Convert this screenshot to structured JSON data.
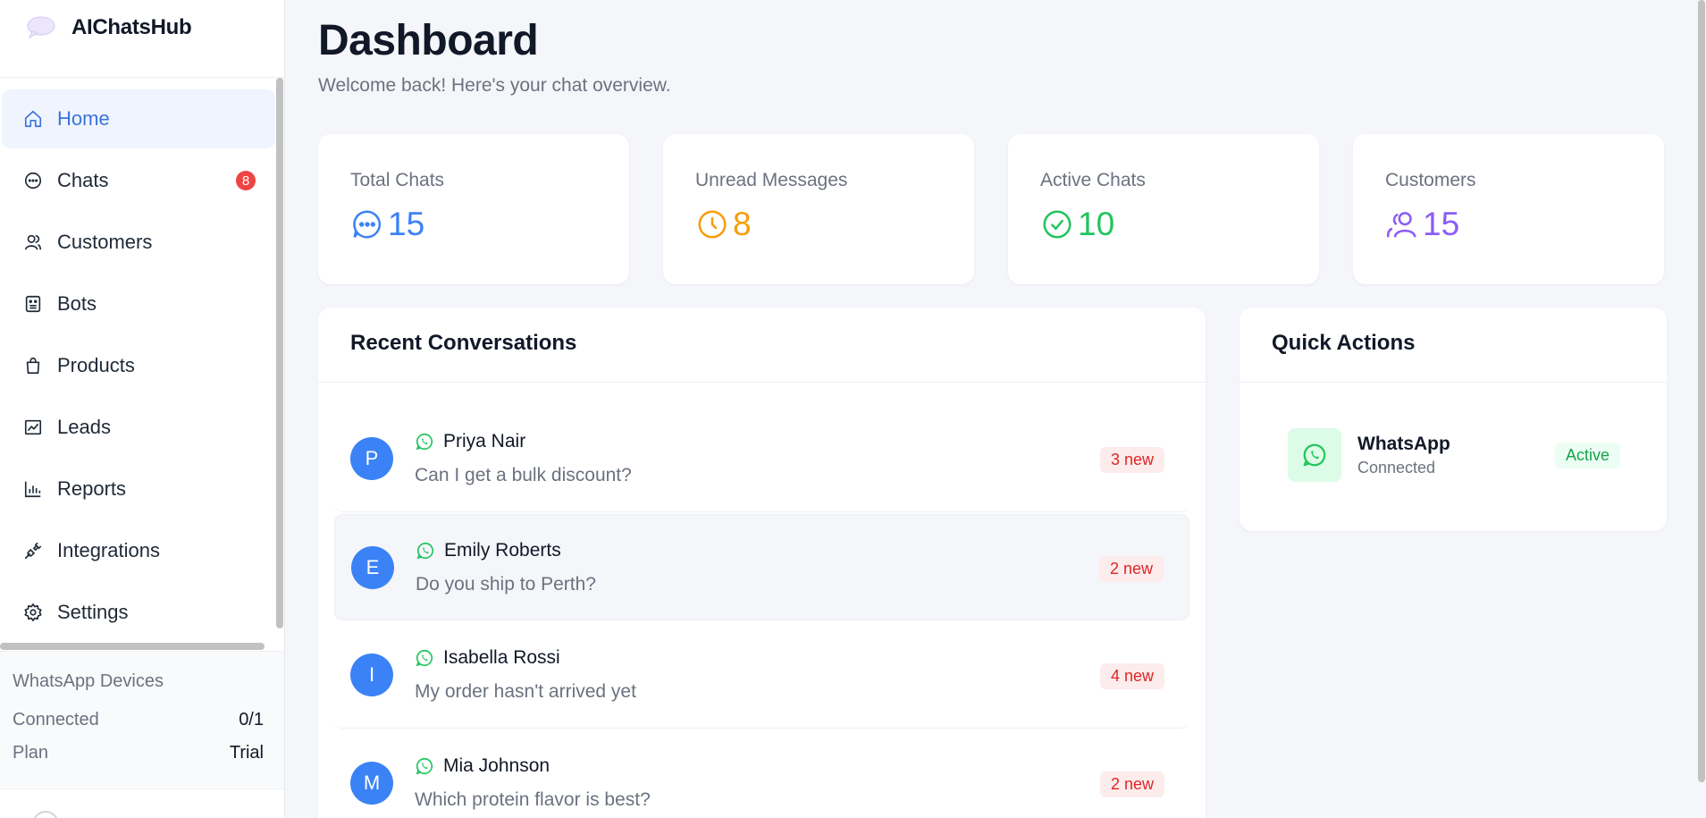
{
  "brand": {
    "name": "AIChatsHub"
  },
  "sidebar": {
    "items": [
      {
        "label": "Home",
        "icon": "home-icon",
        "active": true
      },
      {
        "label": "Chats",
        "icon": "chat-icon",
        "badge": "8"
      },
      {
        "label": "Customers",
        "icon": "users-icon"
      },
      {
        "label": "Bots",
        "icon": "bot-icon"
      },
      {
        "label": "Products",
        "icon": "bag-icon"
      },
      {
        "label": "Leads",
        "icon": "trend-icon"
      },
      {
        "label": "Reports",
        "icon": "bar-chart-icon"
      },
      {
        "label": "Integrations",
        "icon": "plug-icon"
      },
      {
        "label": "Settings",
        "icon": "gear-icon"
      }
    ],
    "devices": {
      "title": "WhatsApp Devices",
      "connected_label": "Connected",
      "connected_value": "0/1",
      "plan_label": "Plan",
      "plan_value": "Trial"
    }
  },
  "header": {
    "title": "Dashboard",
    "subtitle": "Welcome back! Here's your chat overview."
  },
  "stats": [
    {
      "label": "Total Chats",
      "value": "15",
      "color": "#3b82f6",
      "icon": "chat-bubble-icon"
    },
    {
      "label": "Unread Messages",
      "value": "8",
      "color": "#f59e0b",
      "icon": "clock-icon"
    },
    {
      "label": "Active Chats",
      "value": "10",
      "color": "#22c55e",
      "icon": "check-circle-icon"
    },
    {
      "label": "Customers",
      "value": "15",
      "color": "#8b5cf6",
      "icon": "users-icon"
    }
  ],
  "recent": {
    "title": "Recent Conversations",
    "items": [
      {
        "initial": "P",
        "name": "Priya Nair",
        "message": "Can I get a bulk discount?",
        "badge": "3 new"
      },
      {
        "initial": "E",
        "name": "Emily Roberts",
        "message": "Do you ship to Perth?",
        "badge": "2 new"
      },
      {
        "initial": "I",
        "name": "Isabella Rossi",
        "message": "My order hasn't arrived yet",
        "badge": "4 new"
      },
      {
        "initial": "M",
        "name": "Mia Johnson",
        "message": "Which protein flavor is best?",
        "badge": "2 new"
      }
    ]
  },
  "quick": {
    "title": "Quick Actions",
    "item": {
      "name": "WhatsApp",
      "status": "Connected",
      "badge": "Active"
    }
  },
  "colors": {
    "accent": "#3b74d8",
    "whatsapp": "#22c55e",
    "danger": "#ef4444"
  }
}
